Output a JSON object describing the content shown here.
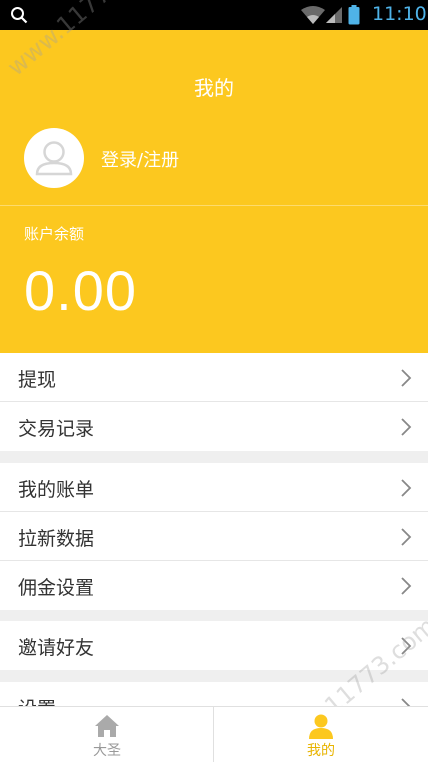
{
  "status_bar": {
    "time": "11:10",
    "icons": [
      "search-icon",
      "wifi-icon",
      "signal-icon",
      "battery-icon"
    ]
  },
  "header": {
    "title": "我的",
    "login_text": "登录/注册",
    "balance_label": "账户余额",
    "balance_value": "0.00",
    "background": "#fcc81f"
  },
  "menu_groups": [
    {
      "items": [
        {
          "label": "提现"
        },
        {
          "label": "交易记录"
        }
      ]
    },
    {
      "items": [
        {
          "label": "我的账单"
        },
        {
          "label": "拉新数据"
        },
        {
          "label": "佣金设置"
        }
      ]
    },
    {
      "items": [
        {
          "label": "邀请好友"
        }
      ]
    },
    {
      "items": [
        {
          "label": "设置"
        }
      ]
    }
  ],
  "tabbar": {
    "tabs": [
      {
        "label": "大圣",
        "icon": "home-icon",
        "color": "#999999"
      },
      {
        "label": "我的",
        "icon": "person-icon",
        "color": "#fcc81f",
        "active": true
      }
    ]
  },
  "watermark": "www.11773.com"
}
